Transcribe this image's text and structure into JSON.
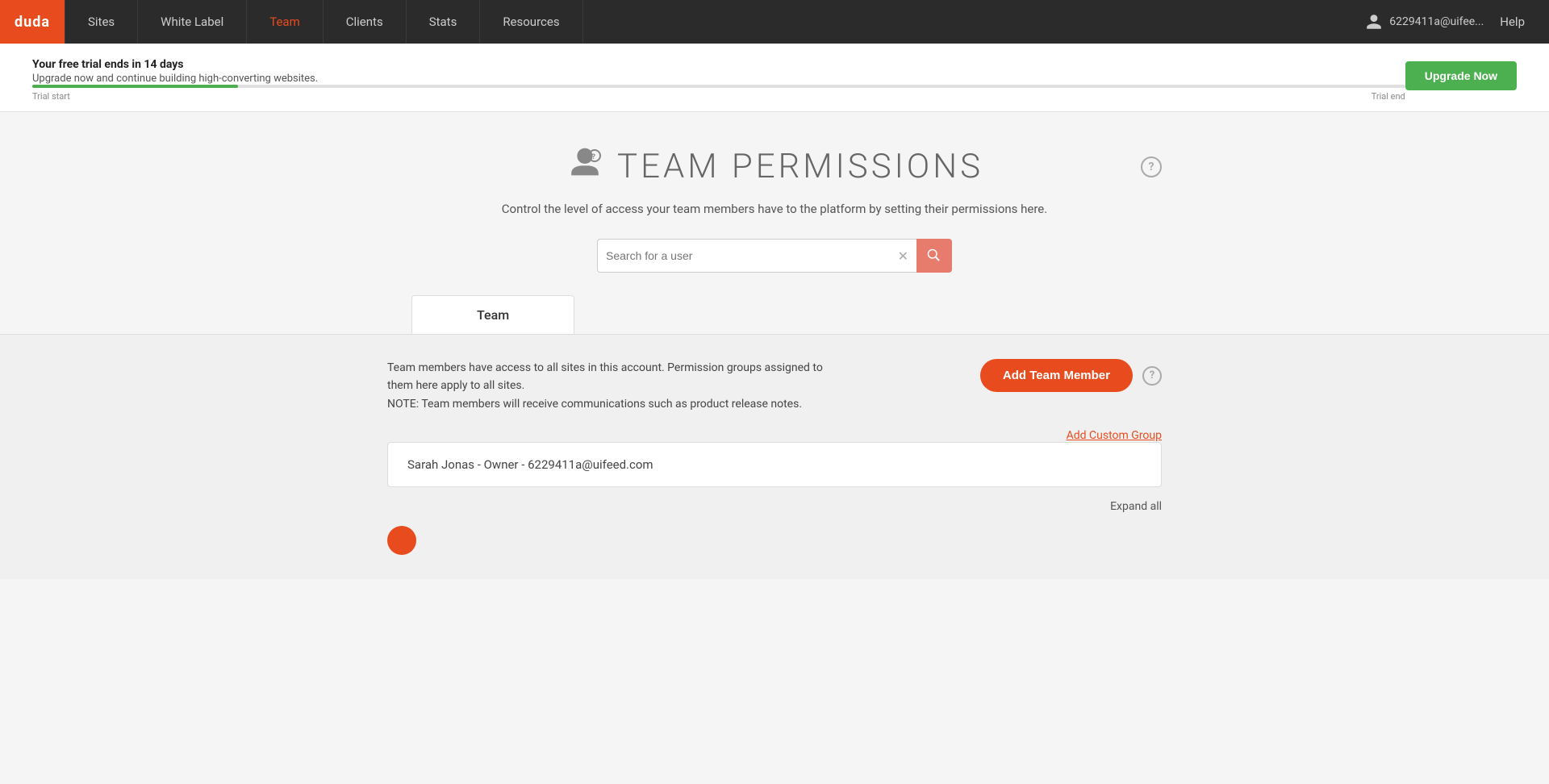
{
  "nav": {
    "logo": "duda",
    "items": [
      {
        "id": "sites",
        "label": "Sites",
        "active": false
      },
      {
        "id": "white-label",
        "label": "White Label",
        "active": false
      },
      {
        "id": "team",
        "label": "Team",
        "active": true
      },
      {
        "id": "clients",
        "label": "Clients",
        "active": false
      },
      {
        "id": "stats",
        "label": "Stats",
        "active": false
      },
      {
        "id": "resources",
        "label": "Resources",
        "active": false
      }
    ],
    "user_email": "6229411a@uifee...",
    "help_label": "Help"
  },
  "trial_banner": {
    "title": "Your free trial ends in 14 days",
    "subtitle": "Upgrade now and continue building high-converting websites.",
    "trial_start_label": "Trial start",
    "trial_end_label": "Trial end",
    "upgrade_btn_label": "Upgrade Now"
  },
  "page": {
    "title": "TEAM PERMISSIONS",
    "subtitle": "Control the level of access your team members have to the platform by setting their permissions here.",
    "search_placeholder": "Search for a user"
  },
  "tabs": [
    {
      "id": "team",
      "label": "Team",
      "active": true
    }
  ],
  "team_section": {
    "description_line1": "Team members have access to all sites in this account. Permission groups assigned to",
    "description_line2": "them here apply to all sites.",
    "description_line3": "NOTE: Team members will receive communications such as product release notes.",
    "add_member_btn": "Add Team Member",
    "add_custom_group_link": "Add Custom Group",
    "member": "Sarah Jonas - Owner - 6229411a@uifeed.com",
    "expand_all": "Expand all"
  }
}
